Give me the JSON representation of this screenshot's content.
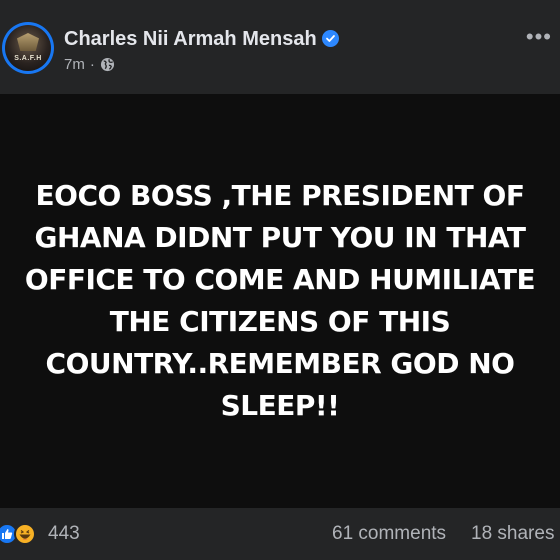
{
  "post": {
    "author": "Charles Nii Armah Mensah",
    "avatar_text": "S.A.F.H",
    "time": "7m",
    "separator": "·",
    "audience_icon": "globe-icon",
    "verified_icon": "verified-badge-icon",
    "text": "EOCO BOSS ,THE PRESIDENT OF GHANA DIDNT PUT YOU IN THAT OFFICE TO COME AND HUMILIATE THE CITIZENS OF THIS COUNTRY..REMEMBER GOD NO SLEEP!!",
    "more_options": "•••"
  },
  "engagement": {
    "reactions": "443",
    "comments": "61 comments",
    "shares": "18 shares",
    "reaction_icons": [
      "like-icon",
      "haha-icon"
    ]
  },
  "colors": {
    "background": "#242526",
    "post_background": "#0e0e0e",
    "verified": "#2d88ff",
    "like": "#1877f2",
    "haha": "#f7b125",
    "secondary_text": "#b0b3b8"
  }
}
